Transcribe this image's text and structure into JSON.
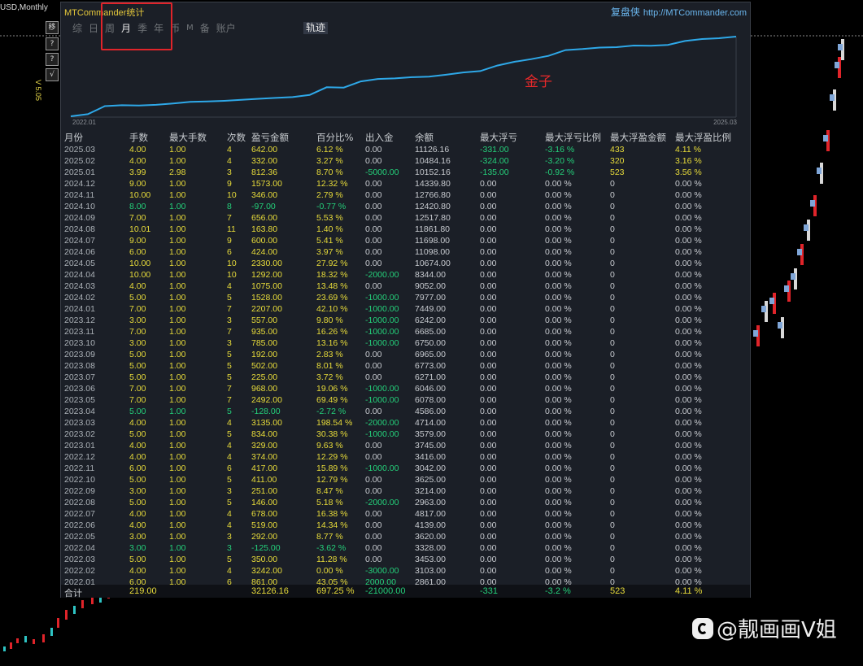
{
  "window": {
    "symbol_label": "USD,Monthly",
    "side_buttons": [
      "移",
      "?",
      "?",
      "√"
    ],
    "side_vertical_label": "V 5.05"
  },
  "panel": {
    "title": "MTCommander统计",
    "brand_cn": "复盘侠",
    "brand_url": "http://MTCommander.com",
    "tabs": [
      {
        "label": "综",
        "active": false
      },
      {
        "label": "日",
        "active": false
      },
      {
        "label": "周",
        "active": false
      },
      {
        "label": "月",
        "active": true
      },
      {
        "label": "季",
        "active": false
      },
      {
        "label": "年",
        "active": false
      },
      {
        "label": "币",
        "active": false
      },
      {
        "label": "M",
        "active": false
      },
      {
        "label": "备",
        "active": false
      },
      {
        "label": "账户",
        "active": false
      }
    ],
    "track_button": "轨迹"
  },
  "equity_chart": {
    "annotation": "金子",
    "x_start": "2022.01",
    "x_end": "2025.03",
    "line_color": "#2ea8e8"
  },
  "colors": {
    "panel_bg": "#1b1f27",
    "yellow": "#e7db3a",
    "green": "#24d07a",
    "accent_red": "#e0242a",
    "link_blue": "#6bb7ef"
  },
  "table": {
    "headers": [
      "月份",
      "手数",
      "最大手数",
      "次数",
      "盈亏金额",
      "百分比%",
      "出入金",
      "余额",
      "最大浮亏",
      "最大浮亏比例",
      "最大浮盈金额",
      "最大浮盈比例"
    ],
    "rows": [
      [
        "2025.03",
        "4.00",
        "1.00",
        "4",
        "642.00",
        "6.12 %",
        "0.00",
        "11126.16",
        "-331.00",
        "-3.16 %",
        "433",
        "4.11 %"
      ],
      [
        "2025.02",
        "4.00",
        "1.00",
        "4",
        "332.00",
        "3.27 %",
        "0.00",
        "10484.16",
        "-324.00",
        "-3.20 %",
        "320",
        "3.16 %"
      ],
      [
        "2025.01",
        "3.99",
        "2.98",
        "3",
        "812.36",
        "8.70 %",
        "-5000.00",
        "10152.16",
        "-135.00",
        "-0.92 %",
        "523",
        "3.56 %"
      ],
      [
        "2024.12",
        "9.00",
        "1.00",
        "9",
        "1573.00",
        "12.32 %",
        "0.00",
        "14339.80",
        "0.00",
        "0.00 %",
        "0",
        "0.00 %"
      ],
      [
        "2024.11",
        "10.00",
        "1.00",
        "10",
        "346.00",
        "2.79 %",
        "0.00",
        "12766.80",
        "0.00",
        "0.00 %",
        "0",
        "0.00 %"
      ],
      [
        "2024.10",
        "8.00",
        "1.00",
        "8",
        "-97.00",
        "-0.77 %",
        "0.00",
        "12420.80",
        "0.00",
        "0.00 %",
        "0",
        "0.00 %"
      ],
      [
        "2024.09",
        "7.00",
        "1.00",
        "7",
        "656.00",
        "5.53 %",
        "0.00",
        "12517.80",
        "0.00",
        "0.00 %",
        "0",
        "0.00 %"
      ],
      [
        "2024.08",
        "10.01",
        "1.00",
        "11",
        "163.80",
        "1.40 %",
        "0.00",
        "11861.80",
        "0.00",
        "0.00 %",
        "0",
        "0.00 %"
      ],
      [
        "2024.07",
        "9.00",
        "1.00",
        "9",
        "600.00",
        "5.41 %",
        "0.00",
        "11698.00",
        "0.00",
        "0.00 %",
        "0",
        "0.00 %"
      ],
      [
        "2024.06",
        "6.00",
        "1.00",
        "6",
        "424.00",
        "3.97 %",
        "0.00",
        "11098.00",
        "0.00",
        "0.00 %",
        "0",
        "0.00 %"
      ],
      [
        "2024.05",
        "10.00",
        "1.00",
        "10",
        "2330.00",
        "27.92 %",
        "0.00",
        "10674.00",
        "0.00",
        "0.00 %",
        "0",
        "0.00 %"
      ],
      [
        "2024.04",
        "10.00",
        "1.00",
        "10",
        "1292.00",
        "18.32 %",
        "-2000.00",
        "8344.00",
        "0.00",
        "0.00 %",
        "0",
        "0.00 %"
      ],
      [
        "2024.03",
        "4.00",
        "1.00",
        "4",
        "1075.00",
        "13.48 %",
        "0.00",
        "9052.00",
        "0.00",
        "0.00 %",
        "0",
        "0.00 %"
      ],
      [
        "2024.02",
        "5.00",
        "1.00",
        "5",
        "1528.00",
        "23.69 %",
        "-1000.00",
        "7977.00",
        "0.00",
        "0.00 %",
        "0",
        "0.00 %"
      ],
      [
        "2024.01",
        "7.00",
        "1.00",
        "7",
        "2207.00",
        "42.10 %",
        "-1000.00",
        "7449.00",
        "0.00",
        "0.00 %",
        "0",
        "0.00 %"
      ],
      [
        "2023.12",
        "3.00",
        "1.00",
        "3",
        "557.00",
        "9.80 %",
        "-1000.00",
        "6242.00",
        "0.00",
        "0.00 %",
        "0",
        "0.00 %"
      ],
      [
        "2023.11",
        "7.00",
        "1.00",
        "7",
        "935.00",
        "16.26 %",
        "-1000.00",
        "6685.00",
        "0.00",
        "0.00 %",
        "0",
        "0.00 %"
      ],
      [
        "2023.10",
        "3.00",
        "1.00",
        "3",
        "785.00",
        "13.16 %",
        "-1000.00",
        "6750.00",
        "0.00",
        "0.00 %",
        "0",
        "0.00 %"
      ],
      [
        "2023.09",
        "5.00",
        "1.00",
        "5",
        "192.00",
        "2.83 %",
        "0.00",
        "6965.00",
        "0.00",
        "0.00 %",
        "0",
        "0.00 %"
      ],
      [
        "2023.08",
        "5.00",
        "1.00",
        "5",
        "502.00",
        "8.01 %",
        "0.00",
        "6773.00",
        "0.00",
        "0.00 %",
        "0",
        "0.00 %"
      ],
      [
        "2023.07",
        "5.00",
        "1.00",
        "5",
        "225.00",
        "3.72 %",
        "0.00",
        "6271.00",
        "0.00",
        "0.00 %",
        "0",
        "0.00 %"
      ],
      [
        "2023.06",
        "7.00",
        "1.00",
        "7",
        "968.00",
        "19.06 %",
        "-1000.00",
        "6046.00",
        "0.00",
        "0.00 %",
        "0",
        "0.00 %"
      ],
      [
        "2023.05",
        "7.00",
        "1.00",
        "7",
        "2492.00",
        "69.49 %",
        "-1000.00",
        "6078.00",
        "0.00",
        "0.00 %",
        "0",
        "0.00 %"
      ],
      [
        "2023.04",
        "5.00",
        "1.00",
        "5",
        "-128.00",
        "-2.72 %",
        "0.00",
        "4586.00",
        "0.00",
        "0.00 %",
        "0",
        "0.00 %"
      ],
      [
        "2023.03",
        "4.00",
        "1.00",
        "4",
        "3135.00",
        "198.54 %",
        "-2000.00",
        "4714.00",
        "0.00",
        "0.00 %",
        "0",
        "0.00 %"
      ],
      [
        "2023.02",
        "5.00",
        "1.00",
        "5",
        "834.00",
        "30.38 %",
        "-1000.00",
        "3579.00",
        "0.00",
        "0.00 %",
        "0",
        "0.00 %"
      ],
      [
        "2023.01",
        "4.00",
        "1.00",
        "4",
        "329.00",
        "9.63 %",
        "0.00",
        "3745.00",
        "0.00",
        "0.00 %",
        "0",
        "0.00 %"
      ],
      [
        "2022.12",
        "4.00",
        "1.00",
        "4",
        "374.00",
        "12.29 %",
        "0.00",
        "3416.00",
        "0.00",
        "0.00 %",
        "0",
        "0.00 %"
      ],
      [
        "2022.11",
        "6.00",
        "1.00",
        "6",
        "417.00",
        "15.89 %",
        "-1000.00",
        "3042.00",
        "0.00",
        "0.00 %",
        "0",
        "0.00 %"
      ],
      [
        "2022.10",
        "5.00",
        "1.00",
        "5",
        "411.00",
        "12.79 %",
        "0.00",
        "3625.00",
        "0.00",
        "0.00 %",
        "0",
        "0.00 %"
      ],
      [
        "2022.09",
        "3.00",
        "1.00",
        "3",
        "251.00",
        "8.47 %",
        "0.00",
        "3214.00",
        "0.00",
        "0.00 %",
        "0",
        "0.00 %"
      ],
      [
        "2022.08",
        "5.00",
        "1.00",
        "5",
        "146.00",
        "5.18 %",
        "-2000.00",
        "2963.00",
        "0.00",
        "0.00 %",
        "0",
        "0.00 %"
      ],
      [
        "2022.07",
        "4.00",
        "1.00",
        "4",
        "678.00",
        "16.38 %",
        "0.00",
        "4817.00",
        "0.00",
        "0.00 %",
        "0",
        "0.00 %"
      ],
      [
        "2022.06",
        "4.00",
        "1.00",
        "4",
        "519.00",
        "14.34 %",
        "0.00",
        "4139.00",
        "0.00",
        "0.00 %",
        "0",
        "0.00 %"
      ],
      [
        "2022.05",
        "3.00",
        "1.00",
        "3",
        "292.00",
        "8.77 %",
        "0.00",
        "3620.00",
        "0.00",
        "0.00 %",
        "0",
        "0.00 %"
      ],
      [
        "2022.04",
        "3.00",
        "1.00",
        "3",
        "-125.00",
        "-3.62 %",
        "0.00",
        "3328.00",
        "0.00",
        "0.00 %",
        "0",
        "0.00 %"
      ],
      [
        "2022.03",
        "5.00",
        "1.00",
        "5",
        "350.00",
        "11.28 %",
        "0.00",
        "3453.00",
        "0.00",
        "0.00 %",
        "0",
        "0.00 %"
      ],
      [
        "2022.02",
        "4.00",
        "1.00",
        "4",
        "3242.00",
        "0.00 %",
        "-3000.00",
        "3103.00",
        "0.00",
        "0.00 %",
        "0",
        "0.00 %"
      ],
      [
        "2022.01",
        "6.00",
        "1.00",
        "6",
        "861.00",
        "43.05 %",
        "2000.00",
        "2861.00",
        "0.00",
        "0.00 %",
        "0",
        "0.00 %"
      ]
    ],
    "total": {
      "label": "合计",
      "lots": "219.00",
      "pnl": "32126.16",
      "percent": "697.25 %",
      "deposit": "-21000.00",
      "max_float_loss": "-331",
      "max_float_loss_pct": "-3.2 %",
      "max_float_profit": "523",
      "max_float_profit_pct": "4.11 %"
    }
  },
  "watermark": {
    "text": "@靓画画V姐"
  }
}
